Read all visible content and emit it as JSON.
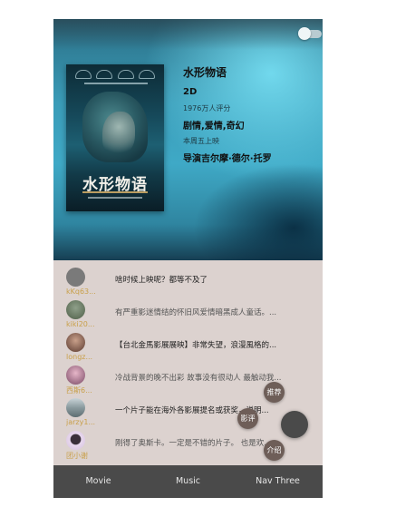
{
  "movie": {
    "title": "水形物语",
    "poster_title": "水形物语",
    "dimension": "2D",
    "rating_count": "1976万人评分",
    "genres": "剧情,爱情,奇幻",
    "release": "本周五上映",
    "director": "导演吉尔摩·德尔·托罗"
  },
  "comments": [
    {
      "user": "kKq63...",
      "text": "啥时候上映呢？都等不及了",
      "avatar_color": "#7a7a7a"
    },
    {
      "user": "kiki20...",
      "text": "有严重影迷情结的怀旧风爱情暗黑成人童话。...",
      "avatar_color": "#6f7f66"
    },
    {
      "user": "longz...",
      "text": "【台北金馬影展展映】非常失望，浪漫風格的...",
      "avatar_color": "#6a4a3e"
    },
    {
      "user": "西斯6...",
      "text": "冷战背景的晚不出彩 故事没有很动人 最触动我...",
      "avatar_color": "#a06a86"
    },
    {
      "user": "jarzy1...",
      "text": "一个片子能在海外各影展提名或获奖，说明...",
      "avatar_color": "#7e8a8e"
    },
    {
      "user": "团小谢",
      "text": "刚得了奥斯卡。一定是不错的片子。 也是欢...",
      "avatar_color": "#d9c6df"
    }
  ],
  "fab": {
    "recommend_label": "推荐",
    "critic_label": "影评",
    "intro_label": "介绍"
  },
  "nav": {
    "items": [
      "Movie",
      "Music",
      "Nav Three"
    ]
  },
  "colors": {
    "hero_accent": "#3fa9c6",
    "username": "#c9a04a",
    "nav_bg": "#4a4a4a",
    "fab_mini": "#6e5e58"
  },
  "icons": [
    "toggle-switch-icon",
    "fab-menu-icon"
  ]
}
